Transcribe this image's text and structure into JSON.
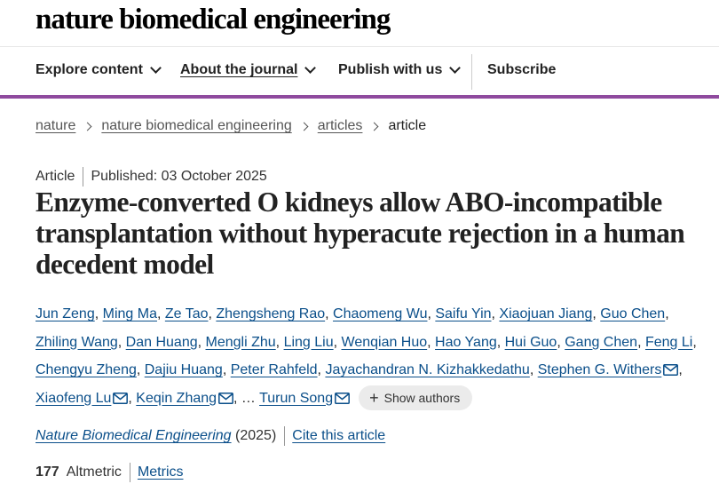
{
  "site": {
    "logo": "nature biomedical engineering"
  },
  "nav": {
    "explore": "Explore content",
    "about": "About the journal",
    "publish": "Publish with us",
    "subscribe": "Subscribe"
  },
  "breadcrumb": [
    "nature",
    "nature biomedical engineering",
    "articles",
    "article"
  ],
  "article": {
    "type": "Article",
    "published": "Published: 03 October 2025",
    "title": "Enzyme-converted O kidneys allow ABO-incompatible transplantation without hyperacute rejection in a human decedent model",
    "authors": [
      "Jun Zeng",
      "Ming Ma",
      "Ze Tao",
      "Zhengsheng Rao",
      "Chaomeng Wu",
      "Saifu Yin",
      "Xiaojuan Jiang",
      "Guo Chen",
      "Zhiling Wang",
      "Dan Huang",
      "Mengli Zhu",
      "Ling Liu",
      "Wenqian Huo",
      "Hao Yang",
      "Hui Guo",
      "Gang Chen",
      "Feng Li",
      "Chengyu Zheng",
      "Dajiu Huang",
      "Peter Rahfeld",
      "Jayachandran N. Kizhakkedathu",
      "Stephen G. Withers",
      "Xiaofeng Lu",
      "Keqin Zhang",
      "Turun Song"
    ],
    "ellipsis": "…",
    "show_authors": "Show authors",
    "journal": "Nature Biomedical Engineering",
    "year": "(2025)",
    "cite": "Cite this article",
    "altmetric_score": "177",
    "altmetric_label": "Altmetric",
    "metrics": "Metrics"
  },
  "colors": {
    "accent": "#8f4a9e",
    "link": "#0b4f8a"
  }
}
